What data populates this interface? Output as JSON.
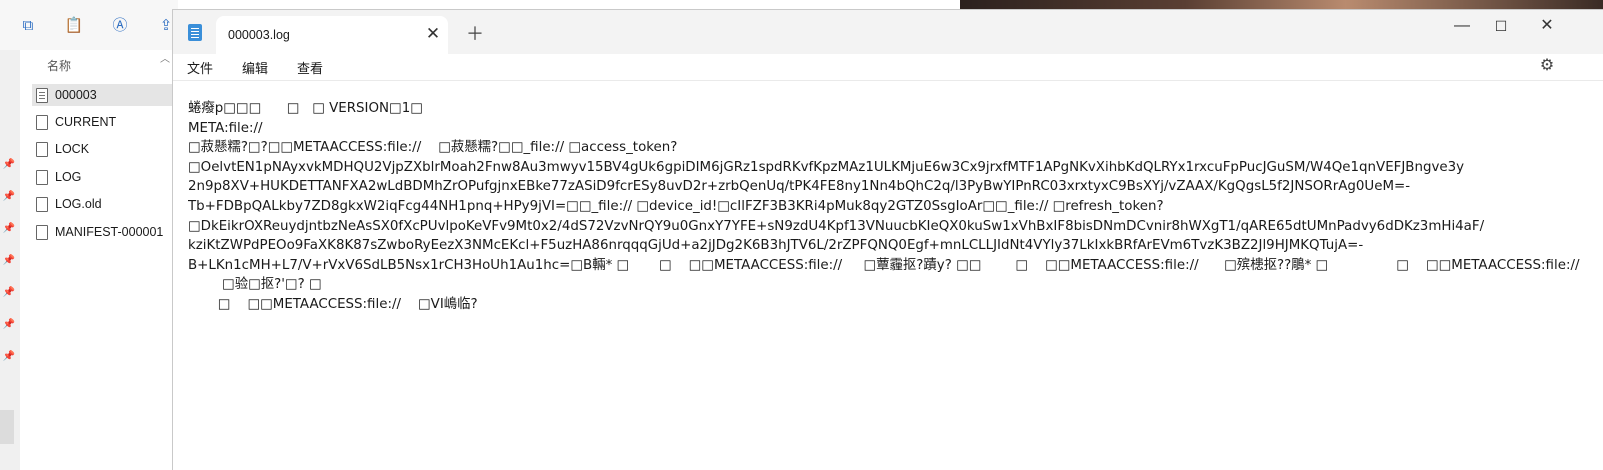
{
  "explorer": {
    "column_header": "名称",
    "files": [
      {
        "name": "000003",
        "selected": true,
        "icon": "file-icon"
      },
      {
        "name": "CURRENT",
        "selected": false,
        "icon": "file-icon"
      },
      {
        "name": "LOCK",
        "selected": false,
        "icon": "file-icon"
      },
      {
        "name": "LOG",
        "selected": false,
        "icon": "file-icon"
      },
      {
        "name": "LOG.old",
        "selected": false,
        "icon": "file-icon"
      },
      {
        "name": "MANIFEST-000001",
        "selected": false,
        "icon": "file-icon"
      }
    ]
  },
  "notepad": {
    "tab_title": "000003.log",
    "menu": {
      "file": "文件",
      "edit": "编辑",
      "view": "查看"
    },
    "lines": [
      "蜷癈p□□□      □   □ VERSION□1□",
      "META:file://",
      "□菽懸糯?□?□□METAACCESS:file://    □菽懸糯?□□_file:// □access_token?",
      "□OelvtEN1pNAyxvkMDHQU2VjpZXblrMoah2Fnw8Au3mwyv15BV4gUk6gpiDIM6jGRz1spdRKvfKpzMAz1ULKMjuE6w3Cx9jrxfMTF1APgNKvXihbKdQLRYx1rxcuFpPucJGuSM/W4Qe1qnVEFJBngve3y",
      "2n9p8XV+HUKDETTANFXA2wLdBDMhZrOPufgjnxEBke77zASiD9fcrESy8uvD2r+zrbQenUq/tPK4FE8ny1Nn4bQhC2q/l3PyBwYIPnRC03xrxtyxC9BsXYj/vZAAX/KgQgsL5f2JNSORrAg0UeM=-",
      "Tb+FDBpQALkby7ZD8gkxW2iqFcg44NH1pnq+HPy9jVI=□□_file:// □device_id!□cIlFZF3B3KRi4pMuk8qy2GTZ0SsgIoAr□□_file:// □refresh_token?",
      "□DkEikrOXReuydjntbzNeAsSX0fXcPUvlpoKeVFv9Mt0x2/4dS72VzvNrQY9u0GnxY7YFE+sN9zdU4Kpf13VNuucbKIeQX0kuSw1xVhBxIF8bisDNmDCvnir8hWXgT1/qARE65dtUMnPadvy6dDKz3mHi4aF/",
      "kziKtZWPdPEOo9FaXK8K87sZwboRyEezX3NMcEKcl+F5uzHA86nrqqqGjUd+a2jJDg2K6B3hJTV6L/2rZPFQNQ0Egf+mnLCLLJIdNt4VYly37LkIxkBRfArEVm6TvzK3BZ2Jl9HJMKQTujA=-",
      "B+LKn1cMH+L7/V+rVxV6SdLB5Nsx1rCH3HoUh1Au1hc=□B輛* □       □    □□METAACCESS:file://     □蕈霾抠?蹟y? □□        □    □□METAACCESS:file://      □殡槵抠??鵰* □                □    □□METAACCESS:file://",
      "        □验□抠?'□? □",
      "       □    □□METAACCESS:file://    □VI嶋临?"
    ]
  }
}
